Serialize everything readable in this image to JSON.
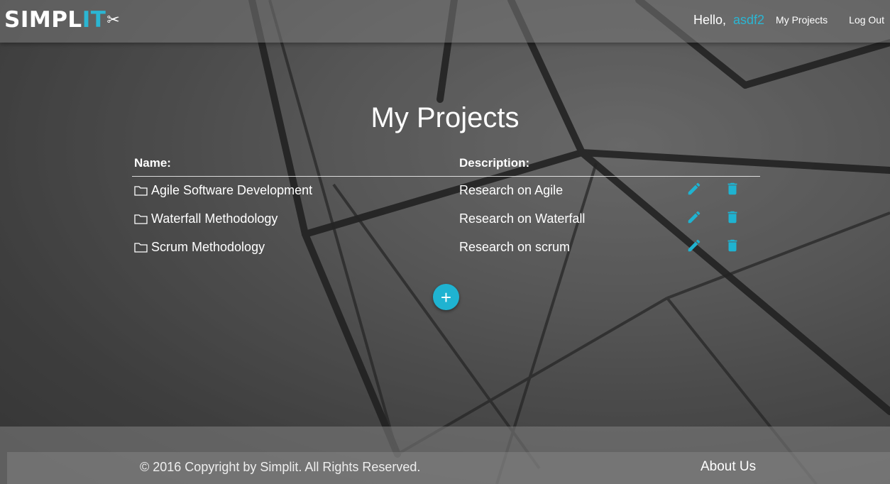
{
  "brand": {
    "logo_main": "SIMPL",
    "logo_accent": "IT",
    "logo_icon": "scissors-icon"
  },
  "header": {
    "greeting": "Hello,",
    "username": "asdf2",
    "nav": [
      {
        "label": "My Projects"
      },
      {
        "label": "Log Out"
      }
    ]
  },
  "main": {
    "title": "My Projects",
    "columns": {
      "name": "Name:",
      "description": "Description:"
    },
    "projects": [
      {
        "name": "Agile Software Development",
        "description": "Research on Agile"
      },
      {
        "name": "Waterfall Methodology",
        "description": "Research on Waterfall"
      },
      {
        "name": "Scrum Methodology",
        "description": "Research on scrum"
      }
    ],
    "add_label": "+"
  },
  "footer": {
    "copyright": "© 2016 Copyright by Simplit. All Rights Reserved.",
    "about": "About Us"
  },
  "colors": {
    "accent": "#1fb3d1",
    "text": "#ffffff"
  }
}
